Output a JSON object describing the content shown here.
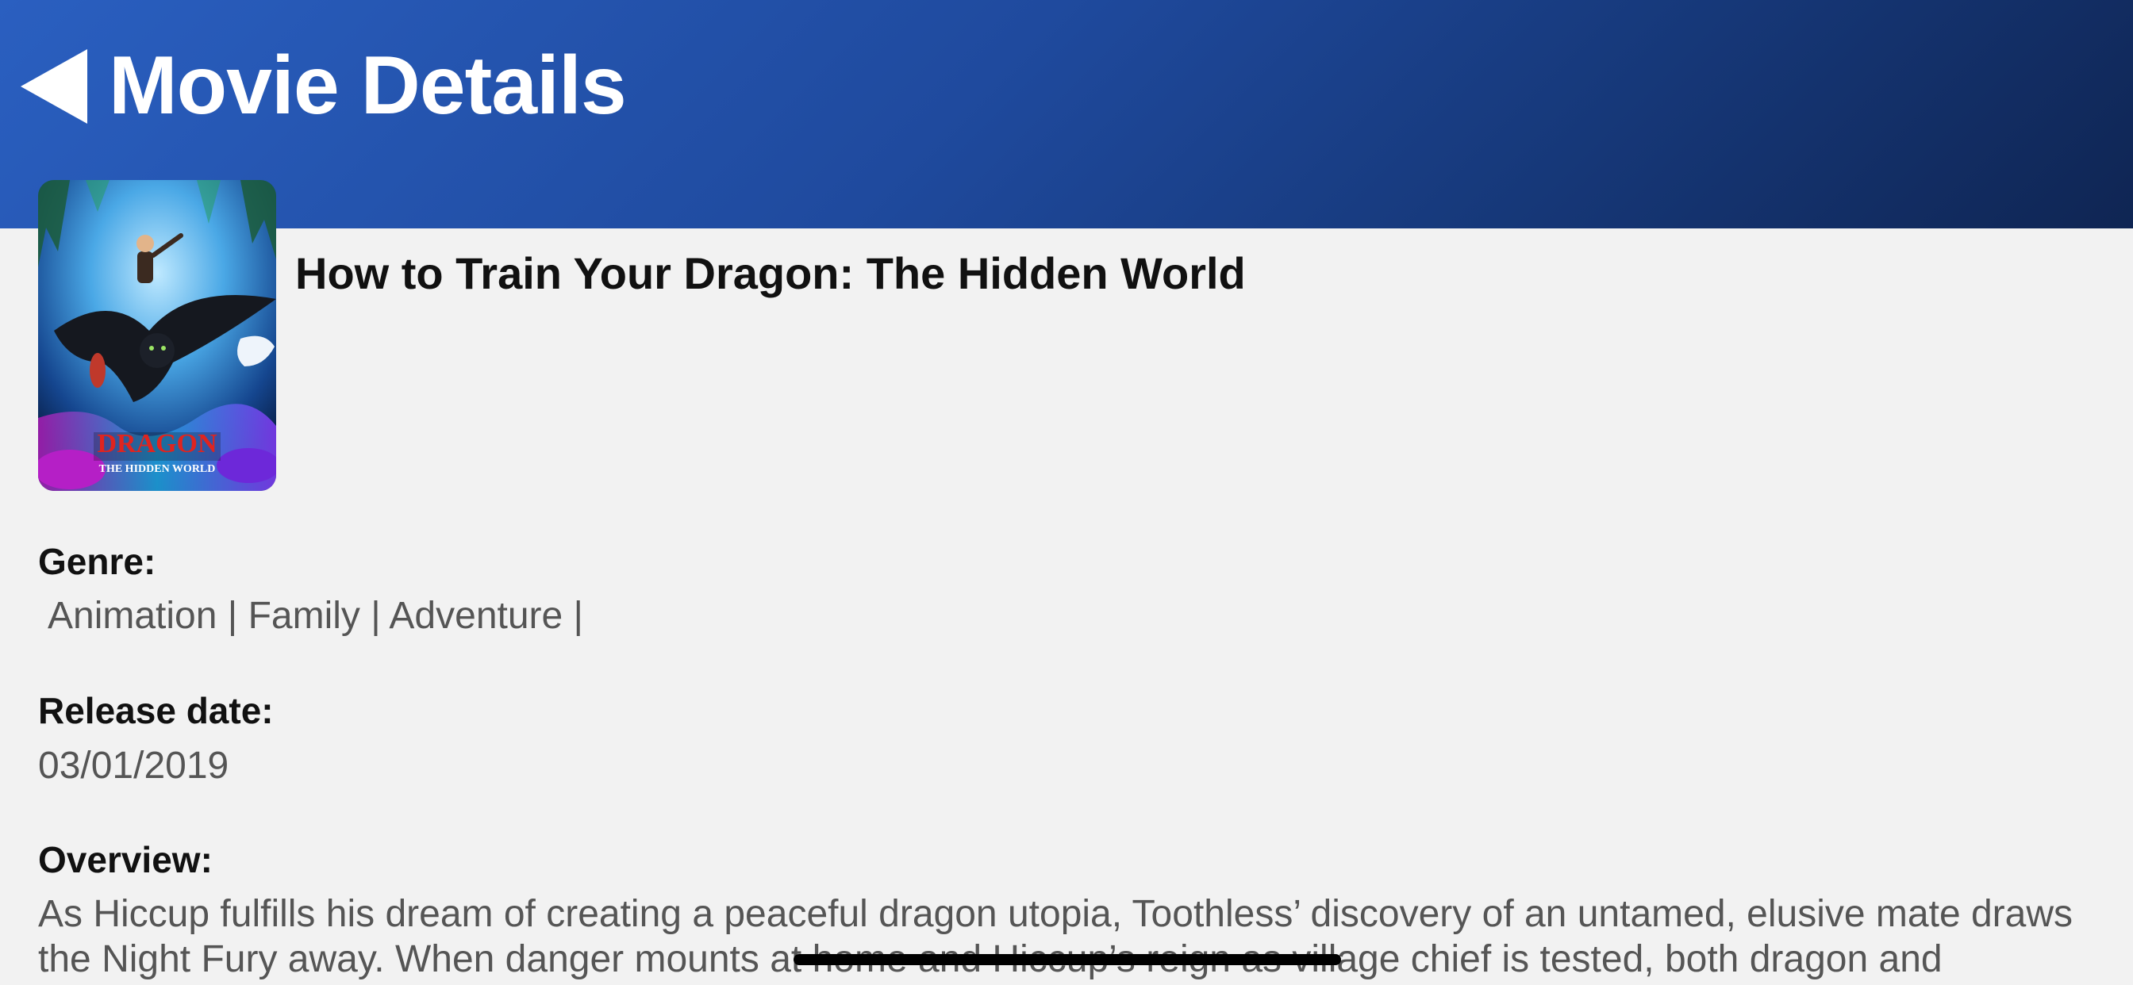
{
  "header": {
    "title": "Movie Details",
    "back_icon": "back-triangle-icon"
  },
  "movie": {
    "title": "How to Train Your Dragon: The Hidden World",
    "poster": {
      "headline": "DRAGON",
      "subtitle": "THE HIDDEN WORLD"
    },
    "genre_label": "Genre:",
    "genre_value": " Animation | Family | Adventure |",
    "release_label": "Release date:",
    "release_value": "03/01/2019",
    "overview_label": "Overview:",
    "overview_value": "As Hiccup fulfills his dream of creating a peaceful dragon utopia, Toothless’ discovery of an untamed, elusive mate draws the Night Fury away. When danger mounts at home and Hiccup’s reign as village chief is tested, both dragon and"
  },
  "colors": {
    "header_start": "#2a5fc0",
    "header_end": "#0f2553",
    "background": "#f2f2f2"
  }
}
